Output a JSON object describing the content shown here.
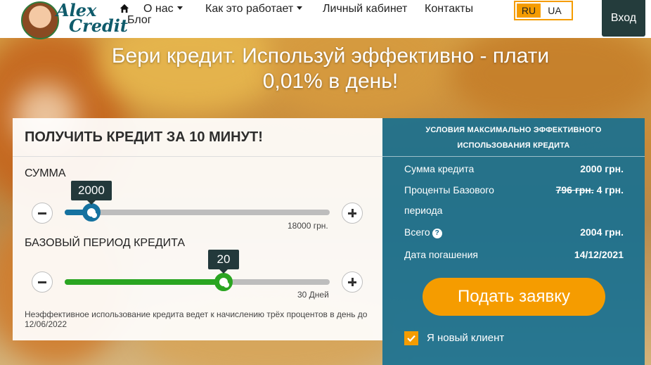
{
  "logo": {
    "line1": "Alex",
    "line2": "Credit"
  },
  "nav": {
    "about": "О нас",
    "how_it_works": "Как это работает",
    "cabinet": "Личный кабинет",
    "contacts": "Контакты",
    "blog": "Блог"
  },
  "lang": {
    "ru": "RU",
    "ua": "UA",
    "active": "RU"
  },
  "login_label": "Вход",
  "hero": {
    "line1": "Бери кредит. Используй эффективно - плати",
    "line2": "0,01% в день!"
  },
  "calculator": {
    "title": "ПОЛУЧИТЬ КРЕДИТ ЗА 10 МИНУТ!",
    "amount": {
      "label": "СУММА",
      "value": "2000",
      "max_label": "18000 грн.",
      "fraction": 0.1,
      "color": "#1572a0"
    },
    "period": {
      "label": "БАЗОВЫЙ ПЕРИОД КРЕДИТА",
      "value": "20",
      "max_label": "30 Дней",
      "fraction": 0.6,
      "color": "#2aa521"
    },
    "note": "Неэффективное использование кредита ведет к начислению трёх процентов в день до 12/06/2022"
  },
  "summary": {
    "title_line1": "УСЛОВИЯ МАКСИМАЛЬНО ЭФФЕКТИВНОГО",
    "title_line2": "ИСПОЛЬЗОВАНИЯ КРЕДИТА",
    "rows": [
      {
        "label": "Сумма кредита",
        "value": "2000 грн."
      },
      {
        "label_line1": "Проценты Базового",
        "label_line2": "периода",
        "old_value": "796 грн.",
        "value": "4 грн."
      },
      {
        "label": "Всего",
        "value": "2004 грн."
      },
      {
        "label": "Дата погашения",
        "value": "14/12/2021"
      }
    ],
    "apply_label": "Подать заявку",
    "new_client_label": "Я новый клиент",
    "new_client_checked": true
  }
}
